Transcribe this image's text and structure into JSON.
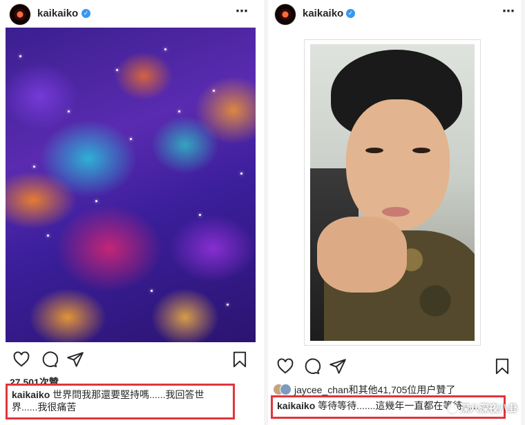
{
  "left_post": {
    "username": "kaikaiko",
    "likes": "27,501次贊",
    "caption_user": "kaikaiko",
    "caption_text": "世界問我那還要堅持嗎......我回答世界......我很痛苦"
  },
  "right_post": {
    "username": "kaikaiko",
    "likes_text": "jaycee_chan和其他41,705位用户贊了",
    "caption_user": "kaikaiko",
    "caption_text": "等待等待.......這幾年一直都在等待......"
  },
  "icons": {
    "more": "⋯",
    "verified": "✓",
    "like": "heart-icon",
    "comment": "comment-icon",
    "share": "send-icon",
    "save": "bookmark-icon"
  },
  "watermark": "深八深夜八卦",
  "colors": {
    "highlight_border": "#e0353b",
    "verified": "#3897f0"
  }
}
